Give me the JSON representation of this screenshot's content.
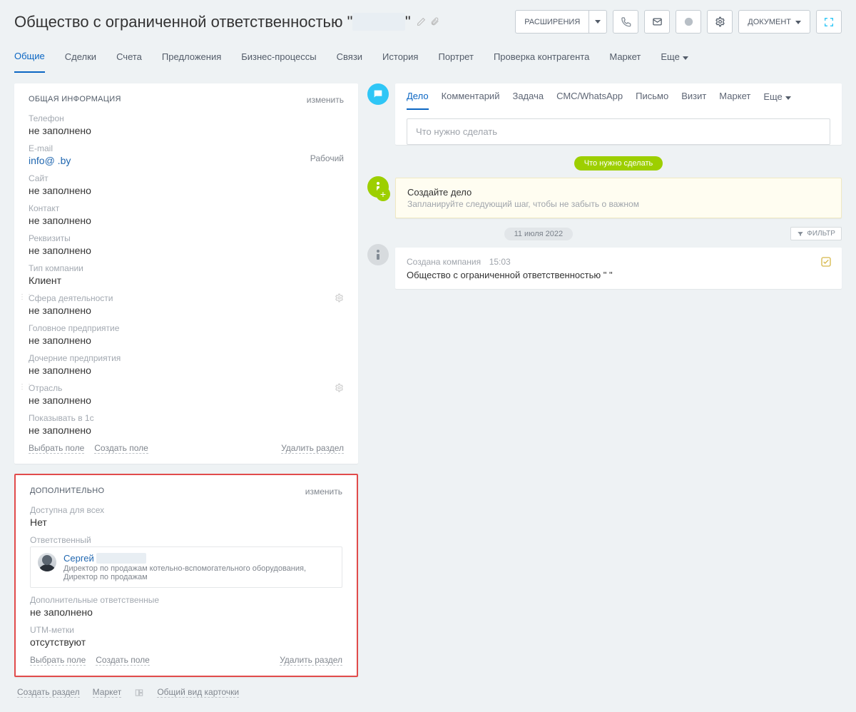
{
  "header": {
    "title_prefix": "Общество с ограниченной ответственностью \"",
    "title_suffix": "\"",
    "extensions_label": "РАСШИРЕНИЯ",
    "document_label": "ДОКУМЕНТ"
  },
  "main_tabs": [
    {
      "label": "Общие",
      "active": true
    },
    {
      "label": "Сделки"
    },
    {
      "label": "Счета"
    },
    {
      "label": "Предложения"
    },
    {
      "label": "Бизнес-процессы"
    },
    {
      "label": "Связи"
    },
    {
      "label": "История"
    },
    {
      "label": "Портрет"
    },
    {
      "label": "Проверка контрагента"
    },
    {
      "label": "Маркет"
    },
    {
      "label": "Еще",
      "dropdown": true
    }
  ],
  "general": {
    "panel_title": "ОБЩАЯ ИНФОРМАЦИЯ",
    "edit_label": "изменить",
    "phone_label": "Телефон",
    "phone_value": "не заполнено",
    "email_label": "E-mail",
    "email_value": "info@        .by",
    "email_tag": "Рабочий",
    "site_label": "Сайт",
    "site_value": "не заполнено",
    "contact_label": "Контакт",
    "contact_value": "не заполнено",
    "requisites_label": "Реквизиты",
    "requisites_value": "не заполнено",
    "companytype_label": "Тип компании",
    "companytype_value": "Клиент",
    "scope_label": "Сфера деятельности",
    "scope_value": "не заполнено",
    "head_label": "Головное предприятие",
    "head_value": "не заполнено",
    "subs_label": "Дочерние предприятия",
    "subs_value": "не заполнено",
    "industry_label": "Отрасль",
    "industry_value": "не заполнено",
    "show1c_label": "Показывать в 1с",
    "show1c_value": "не заполнено",
    "select_field": "Выбрать поле",
    "create_field": "Создать поле",
    "delete_section": "Удалить раздел"
  },
  "additional": {
    "panel_title": "ДОПОЛНИТЕЛЬНО",
    "edit_label": "изменить",
    "available_label": "Доступна для всех",
    "available_value": "Нет",
    "responsible_label": "Ответственный",
    "responsible_name": "Сергей",
    "responsible_role": "Директор по продажам котельно-вспомогательного оборудования, Директор по продажам",
    "addl_resp_label": "Дополнительные ответственные",
    "addl_resp_value": "не заполнено",
    "utm_label": "UTM-метки",
    "utm_value": "отсутствуют",
    "select_field": "Выбрать поле",
    "create_field": "Создать поле",
    "delete_section": "Удалить раздел"
  },
  "bottom": {
    "create_section": "Создать раздел",
    "market": "Маркет",
    "card_view": "Общий вид карточки"
  },
  "feed": {
    "tabs": {
      "delo": "Дело",
      "comment": "Комментарий",
      "task": "Задача",
      "sms": "СМС/WhatsApp",
      "letter": "Письмо",
      "visit": "Визит",
      "market": "Маркет",
      "more": "Еще"
    },
    "input_placeholder": "Что нужно сделать",
    "pill_todo": "Что нужно сделать",
    "create_delo_title": "Создайте дело",
    "create_delo_sub": "Запланируйте следующий шаг, чтобы не забыть о важном",
    "date_pill": "11 июля 2022",
    "filter_label": "ФИЛЬТР",
    "event_title": "Создана компания",
    "event_time": "15:03",
    "event_text": "Общество с ограниченной ответственностью \"            \""
  }
}
